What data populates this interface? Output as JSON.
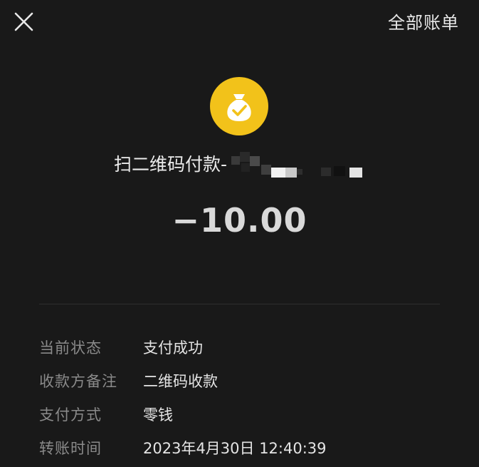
{
  "header": {
    "close_icon": "close-icon",
    "all_bills_label": "全部账单"
  },
  "summary": {
    "icon": "money-bag-check-icon",
    "icon_color": "#f2c21a",
    "merchant_prefix": "扫二维码付款-",
    "amount": "−10.00"
  },
  "details": [
    {
      "label": "当前状态",
      "value": "支付成功"
    },
    {
      "label": "收款方备注",
      "value": "二维码收款"
    },
    {
      "label": "支付方式",
      "value": "零钱"
    },
    {
      "label": "转账时间",
      "value": "2023年4月30日 12:40:39"
    }
  ]
}
